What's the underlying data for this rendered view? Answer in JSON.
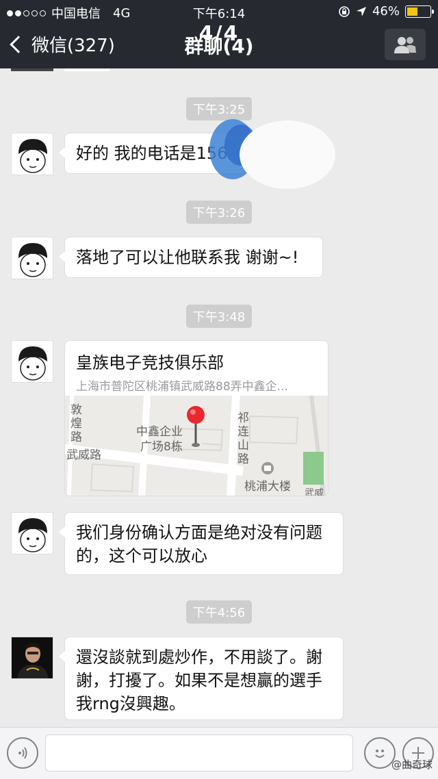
{
  "status_bar": {
    "carrier": "中国电信",
    "network": "4G",
    "time": "下午6:14",
    "battery": "46%"
  },
  "navbar": {
    "back_label": "微信(327)",
    "title": "群聊(4)",
    "page_indicator": "4/4"
  },
  "timestamps": [
    "下午3:25",
    "下午3:26",
    "下午3:48",
    "下午4:56"
  ],
  "messages": [
    {
      "text": "好的 我的电话是156"
    },
    {
      "text": "落地了可以让他联系我 谢谢~!"
    },
    {
      "type": "location",
      "name": "皇族电子竞技俱乐部",
      "address": "上海市普陀区桃浦镇武威路88弄中鑫企...",
      "map_labels": {
        "dun": "敦",
        "huang": "煌",
        "lu": "路",
        "wuwei": "武威路",
        "building_line1": "中鑫企业",
        "building_line2": "广场8栋",
        "qi": "祁",
        "lian": "连",
        "shan": "山",
        "lu2": "路",
        "taopu": "桃浦大楼",
        "wuwei_right": "武威路"
      }
    },
    {
      "line1": "我们身份确认方面是绝对没有问题",
      "line2": "的，这个可以放心"
    },
    {
      "line1": "還沒談就到處炒作，不用談了。謝",
      "line2": "謝，打擾了。如果不是想贏的選手",
      "line3": "我rng沒興趣。"
    }
  ],
  "watermark": "@曲奇球",
  "colors": {
    "header_bg": "#262a30",
    "chat_bg": "#ebebeb",
    "timestamp_bg": "#cecece",
    "map_pin": "#e8282d",
    "battery": "#f3c318"
  }
}
